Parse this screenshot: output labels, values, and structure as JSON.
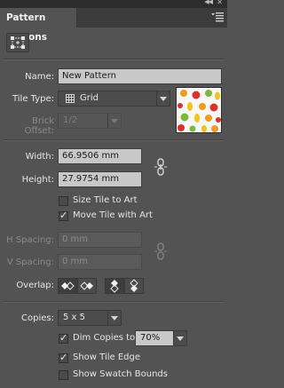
{
  "panel": {
    "title": "Pattern Options"
  },
  "fields": {
    "name_label": "Name:",
    "name_value": "New Pattern",
    "tile_type_label": "Tile Type:",
    "tile_type_value": "Grid",
    "brick_offset_label": "Brick Offset:",
    "brick_offset_value": "1/2",
    "width_label": "Width:",
    "width_value": "66.9506 mm",
    "height_label": "Height:",
    "height_value": "27.9754 mm",
    "size_tile_label": "Size Tile to Art",
    "move_tile_label": "Move Tile with Art",
    "h_spacing_label": "H Spacing:",
    "h_spacing_value": "0 mm",
    "v_spacing_label": "V Spacing:",
    "v_spacing_value": "0 mm",
    "overlap_label": "Overlap:",
    "copies_label": "Copies:",
    "copies_value": "5 x 5",
    "dim_copies_label": "Dim Copies to:",
    "dim_copies_value": "70%",
    "show_tile_edge_label": "Show Tile Edge",
    "show_swatch_bounds_label": "Show Swatch Bounds"
  },
  "checkboxes": {
    "size_tile": false,
    "move_tile": true,
    "dim_copies": true,
    "show_tile_edge": true,
    "show_swatch_bounds": false
  },
  "icons": {
    "tile_tool": "pattern-tile-tool-icon",
    "grid": "grid-icon",
    "link": "chain-link-icon",
    "menu": "panel-menu-icon"
  },
  "colors": {
    "panel_bg": "#535353",
    "field_bg": "#c8c8c8",
    "fruit_red": "#d9322b",
    "fruit_orange": "#f29a1b",
    "fruit_green": "#7cb83a",
    "fruit_yellow": "#f0c419"
  }
}
